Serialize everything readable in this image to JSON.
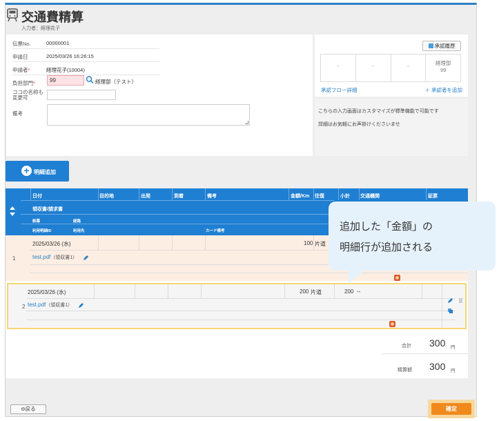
{
  "header": {
    "title": "交通費精算",
    "subtitle": "入力者：経理花子",
    "icon": "train-icon"
  },
  "form": {
    "slip_no": {
      "label": "伝票No.",
      "value": "00000001"
    },
    "request_date": {
      "label": "申請日",
      "value": "2025/03/26 16:26:15"
    },
    "applicant": {
      "label": "申請者",
      "required_mark": "*",
      "value": "経理花子(10004)"
    },
    "dept": {
      "label": "負担部門",
      "required_mark": "*",
      "value": "99",
      "name": "経理部（テスト）"
    },
    "rename": {
      "label": "ココの名称も変更可",
      "value": ""
    },
    "memo": {
      "label": "備考",
      "value": ""
    }
  },
  "approval": {
    "history_button": "承認履歴",
    "cells": [
      "-",
      "-",
      "-"
    ],
    "last_cell_role": "経理部",
    "last_cell_code": "99",
    "flow_detail_link": "承認フロー詳細",
    "add_approver_link": "承認者を追加"
  },
  "notes": {
    "line1": "こちらの入力画面はカスタマイズが標準機能で可能です",
    "line2": "詳細はお気軽にお声掛けくださいませ"
  },
  "add_line_button": "明細追加",
  "table": {
    "headers": {
      "date": "日付",
      "purpose": "目的地",
      "depart": "出発",
      "arrive": "到着",
      "remarks": "備考",
      "amount": "金額/Km",
      "roundtrip": "往復",
      "subtotal": "小計",
      "transport": "交通機関",
      "voucher": "証票",
      "receipt_group": "領収書/請求書",
      "sub_new": "新幕",
      "sub_route": "経路",
      "sub_usage_id": "利用明細ID",
      "sub_user": "利用先",
      "sub_card_note": "カード備考"
    },
    "rows": [
      {
        "num": "1",
        "date": "2025/03/26 (水)",
        "amount": "100",
        "trip": "片道",
        "subtotal": "",
        "transport": "",
        "file": "test.pdf",
        "file_note": "（領収書1）"
      },
      {
        "num": "2",
        "date": "2025/03/26 (水)",
        "amount": "200",
        "trip": "片道",
        "subtotal": "200",
        "transport": "--",
        "file": "test.pdf",
        "file_note": "（領収書1）"
      }
    ]
  },
  "totals": {
    "total_label": "合計",
    "total_value": "300",
    "settle_label": "精算額",
    "settle_value": "300",
    "unit": "円"
  },
  "callout": {
    "line1": "追加した「金額」の",
    "line2": "明細行が追加される"
  },
  "footer": {
    "back_button": "戻る",
    "confirm_button": "確定"
  },
  "colors": {
    "primary": "#1f7fd2",
    "confirm": "#f08a1d",
    "highlight": "#f4d774"
  }
}
